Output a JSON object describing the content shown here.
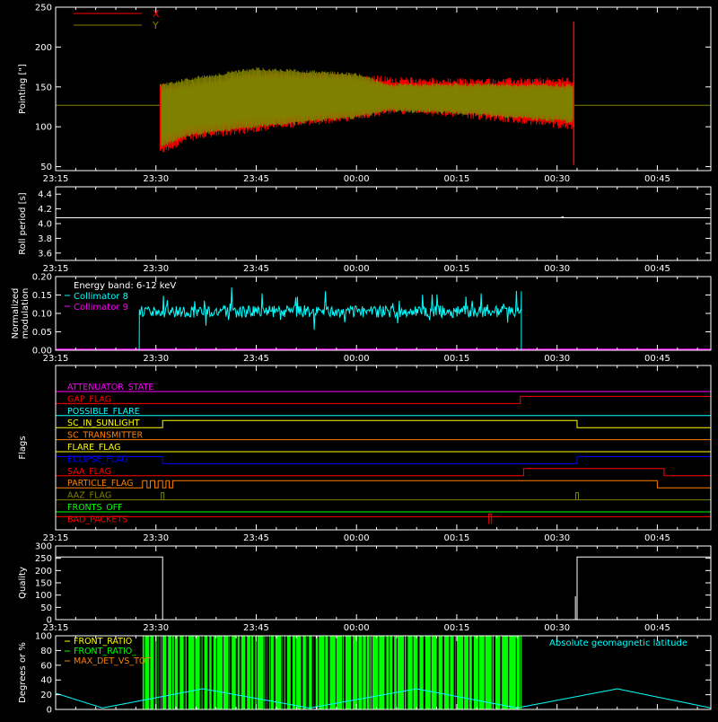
{
  "colors": {
    "background": "#000000",
    "axis": "#ffffff",
    "x_series": "#ff0000",
    "y_series": "#808000",
    "collimator8": "#00ffff",
    "collimator9": "#ff00ff",
    "front_ratio_green": "#00ff00",
    "geomag": "#00ffff"
  },
  "time_ticks": [
    "23:15",
    "23:30",
    "23:45",
    "00:00",
    "00:15",
    "00:30",
    "00:45"
  ],
  "chart_data": [
    {
      "id": "pointing",
      "type": "line",
      "ylabel": "Pointing [\"]",
      "ylim": [
        45,
        250
      ],
      "yticks": [
        "50",
        "100",
        "150",
        "200",
        "250"
      ],
      "ytick_values": [
        50,
        100,
        150,
        200,
        250
      ],
      "time_range": [
        "23:15",
        "00:53"
      ],
      "legend_position": "top-left",
      "series": [
        {
          "name": "X",
          "color": "#ff0000",
          "time": [
            "23:30:40",
            "23:35",
            "23:45",
            "00:00",
            "00:05",
            "00:15",
            "00:32:30"
          ],
          "upper": [
            152,
            150,
            165,
            163,
            159,
            157,
            158
          ],
          "lower": [
            68,
            86,
            97,
            112,
            120,
            116,
            100
          ],
          "baseline": 127
        },
        {
          "name": "Y",
          "color": "#808000",
          "time": [
            "23:30:40",
            "23:35",
            "23:45",
            "00:00",
            "00:05",
            "00:15",
            "00:32:30"
          ],
          "upper": [
            152,
            160,
            173,
            166,
            152,
            153,
            152
          ],
          "lower": [
            75,
            90,
            100,
            112,
            120,
            117,
            106
          ],
          "baseline": 127
        }
      ]
    },
    {
      "id": "roll",
      "type": "line",
      "ylabel": "Roll period [s]",
      "ylim": [
        3.5,
        4.5
      ],
      "yticks": [
        "3.6",
        "3.8",
        "4.0",
        "4.2",
        "4.4"
      ],
      "ytick_values": [
        3.6,
        3.8,
        4.0,
        4.2,
        4.4
      ],
      "series": [
        {
          "name": "",
          "color": "#ffffff",
          "constant": 4.08
        }
      ]
    },
    {
      "id": "modulation",
      "type": "line",
      "ylabel": "Normalized modulation",
      "ylabel_lines": [
        "Normalized",
        "modulation"
      ],
      "ylim": [
        0,
        0.2
      ],
      "yticks": [
        "0.00",
        "0.05",
        "0.10",
        "0.15",
        "0.20"
      ],
      "ytick_values": [
        0,
        0.05,
        0.1,
        0.15,
        0.2
      ],
      "annotation": "Energy band: 6-12 keV",
      "series": [
        {
          "name": "Collimator 8",
          "color": "#00ffff",
          "start": "23:27:30",
          "end": "00:24:40",
          "mean": 0.105,
          "spread": 0.02
        },
        {
          "name": "Collimator 9",
          "color": "#ff00ff",
          "constant": 0.0
        }
      ]
    },
    {
      "id": "flags",
      "type": "line",
      "ylabel": "Flags",
      "series": [
        {
          "name": "ATTENUATOR_STATE",
          "color": "#ff00ff",
          "steps": []
        },
        {
          "name": "GAP_FLAG",
          "color": "#ff0000",
          "steps": [
            [
              "00:24:30",
              1
            ]
          ]
        },
        {
          "name": "POSSIBLE_FLARE",
          "color": "#00ffff",
          "steps": []
        },
        {
          "name": "SC_IN_SUNLIGHT",
          "color": "#ffff00",
          "steps": [
            [
              "23:31",
              1
            ],
            [
              "00:33",
              0
            ]
          ]
        },
        {
          "name": "SC_TRANSMITTER",
          "color": "#ff8000",
          "steps": []
        },
        {
          "name": "FLARE_FLAG",
          "color": "#ffff00",
          "steps": []
        },
        {
          "name": "ECLIPSE_FLAG",
          "color": "#0000ff",
          "start_high": true,
          "steps": [
            [
              "23:31",
              0
            ],
            [
              "00:33",
              1
            ]
          ]
        },
        {
          "name": "SAA_FLAG",
          "color": "#ff0000",
          "steps": [
            [
              "00:25",
              1
            ],
            [
              "00:46",
              0
            ]
          ]
        },
        {
          "name": "PARTICLE_FLAG",
          "color": "#ff8000",
          "steps": [
            [
              "23:28",
              1
            ],
            [
              "23:28:40",
              0
            ],
            [
              "23:29:10",
              1
            ],
            [
              "23:29:50",
              0
            ],
            [
              "23:30:20",
              1
            ],
            [
              "23:31",
              0
            ],
            [
              "23:31:30",
              1
            ],
            [
              "23:32",
              0
            ],
            [
              "23:32:30",
              1
            ],
            [
              "00:45",
              0
            ]
          ]
        },
        {
          "name": "AAZ_FLAG",
          "color": "#808000",
          "pulses": [
            "23:31",
            "00:33"
          ]
        },
        {
          "name": "FRONTS_OFF",
          "color": "#00ff00",
          "steps": []
        },
        {
          "name": "BAD_PACKETS",
          "color": "#ff0000",
          "start_high": true,
          "pulses": [
            "00:20"
          ]
        }
      ]
    },
    {
      "id": "quality",
      "type": "line",
      "ylabel": "Quality",
      "ylim": [
        0,
        300
      ],
      "yticks": [
        "0",
        "50",
        "100",
        "150",
        "200",
        "250",
        "300"
      ],
      "ytick_values": [
        0,
        50,
        100,
        150,
        200,
        250,
        300
      ],
      "series": [
        {
          "name": "",
          "color": "#ffffff",
          "steps": [
            [
              "23:15",
              255
            ],
            [
              "23:31",
              0
            ],
            [
              "00:33",
              255
            ],
            [
              "00:53",
              255
            ]
          ]
        }
      ]
    },
    {
      "id": "ratios",
      "type": "line",
      "ylabel": "Degrees or %",
      "ylim": [
        0,
        100
      ],
      "yticks": [
        "0",
        "20",
        "40",
        "60",
        "80",
        "100"
      ],
      "ytick_values": [
        0,
        20,
        40,
        60,
        80,
        100
      ],
      "annotation": "Absolute geomagnetic latitude",
      "series": [
        {
          "name": "FRONT_RATIO",
          "color": "#ffff00"
        },
        {
          "name": "FRONT_RATIO_",
          "color": "#00ff00",
          "start": "23:28",
          "end": "00:24:40",
          "value": 100
        },
        {
          "name": "MAX_DET_VS_TOT",
          "color": "#ff8000"
        },
        {
          "name": "Absolute geomagnetic latitude",
          "color": "#00ffff",
          "time": [
            "23:15",
            "23:22",
            "23:37",
            "23:53",
            "00:09",
            "00:24",
            "00:39",
            "00:53"
          ],
          "values": [
            22,
            2,
            28,
            2,
            28,
            2,
            28,
            2
          ]
        }
      ]
    }
  ]
}
